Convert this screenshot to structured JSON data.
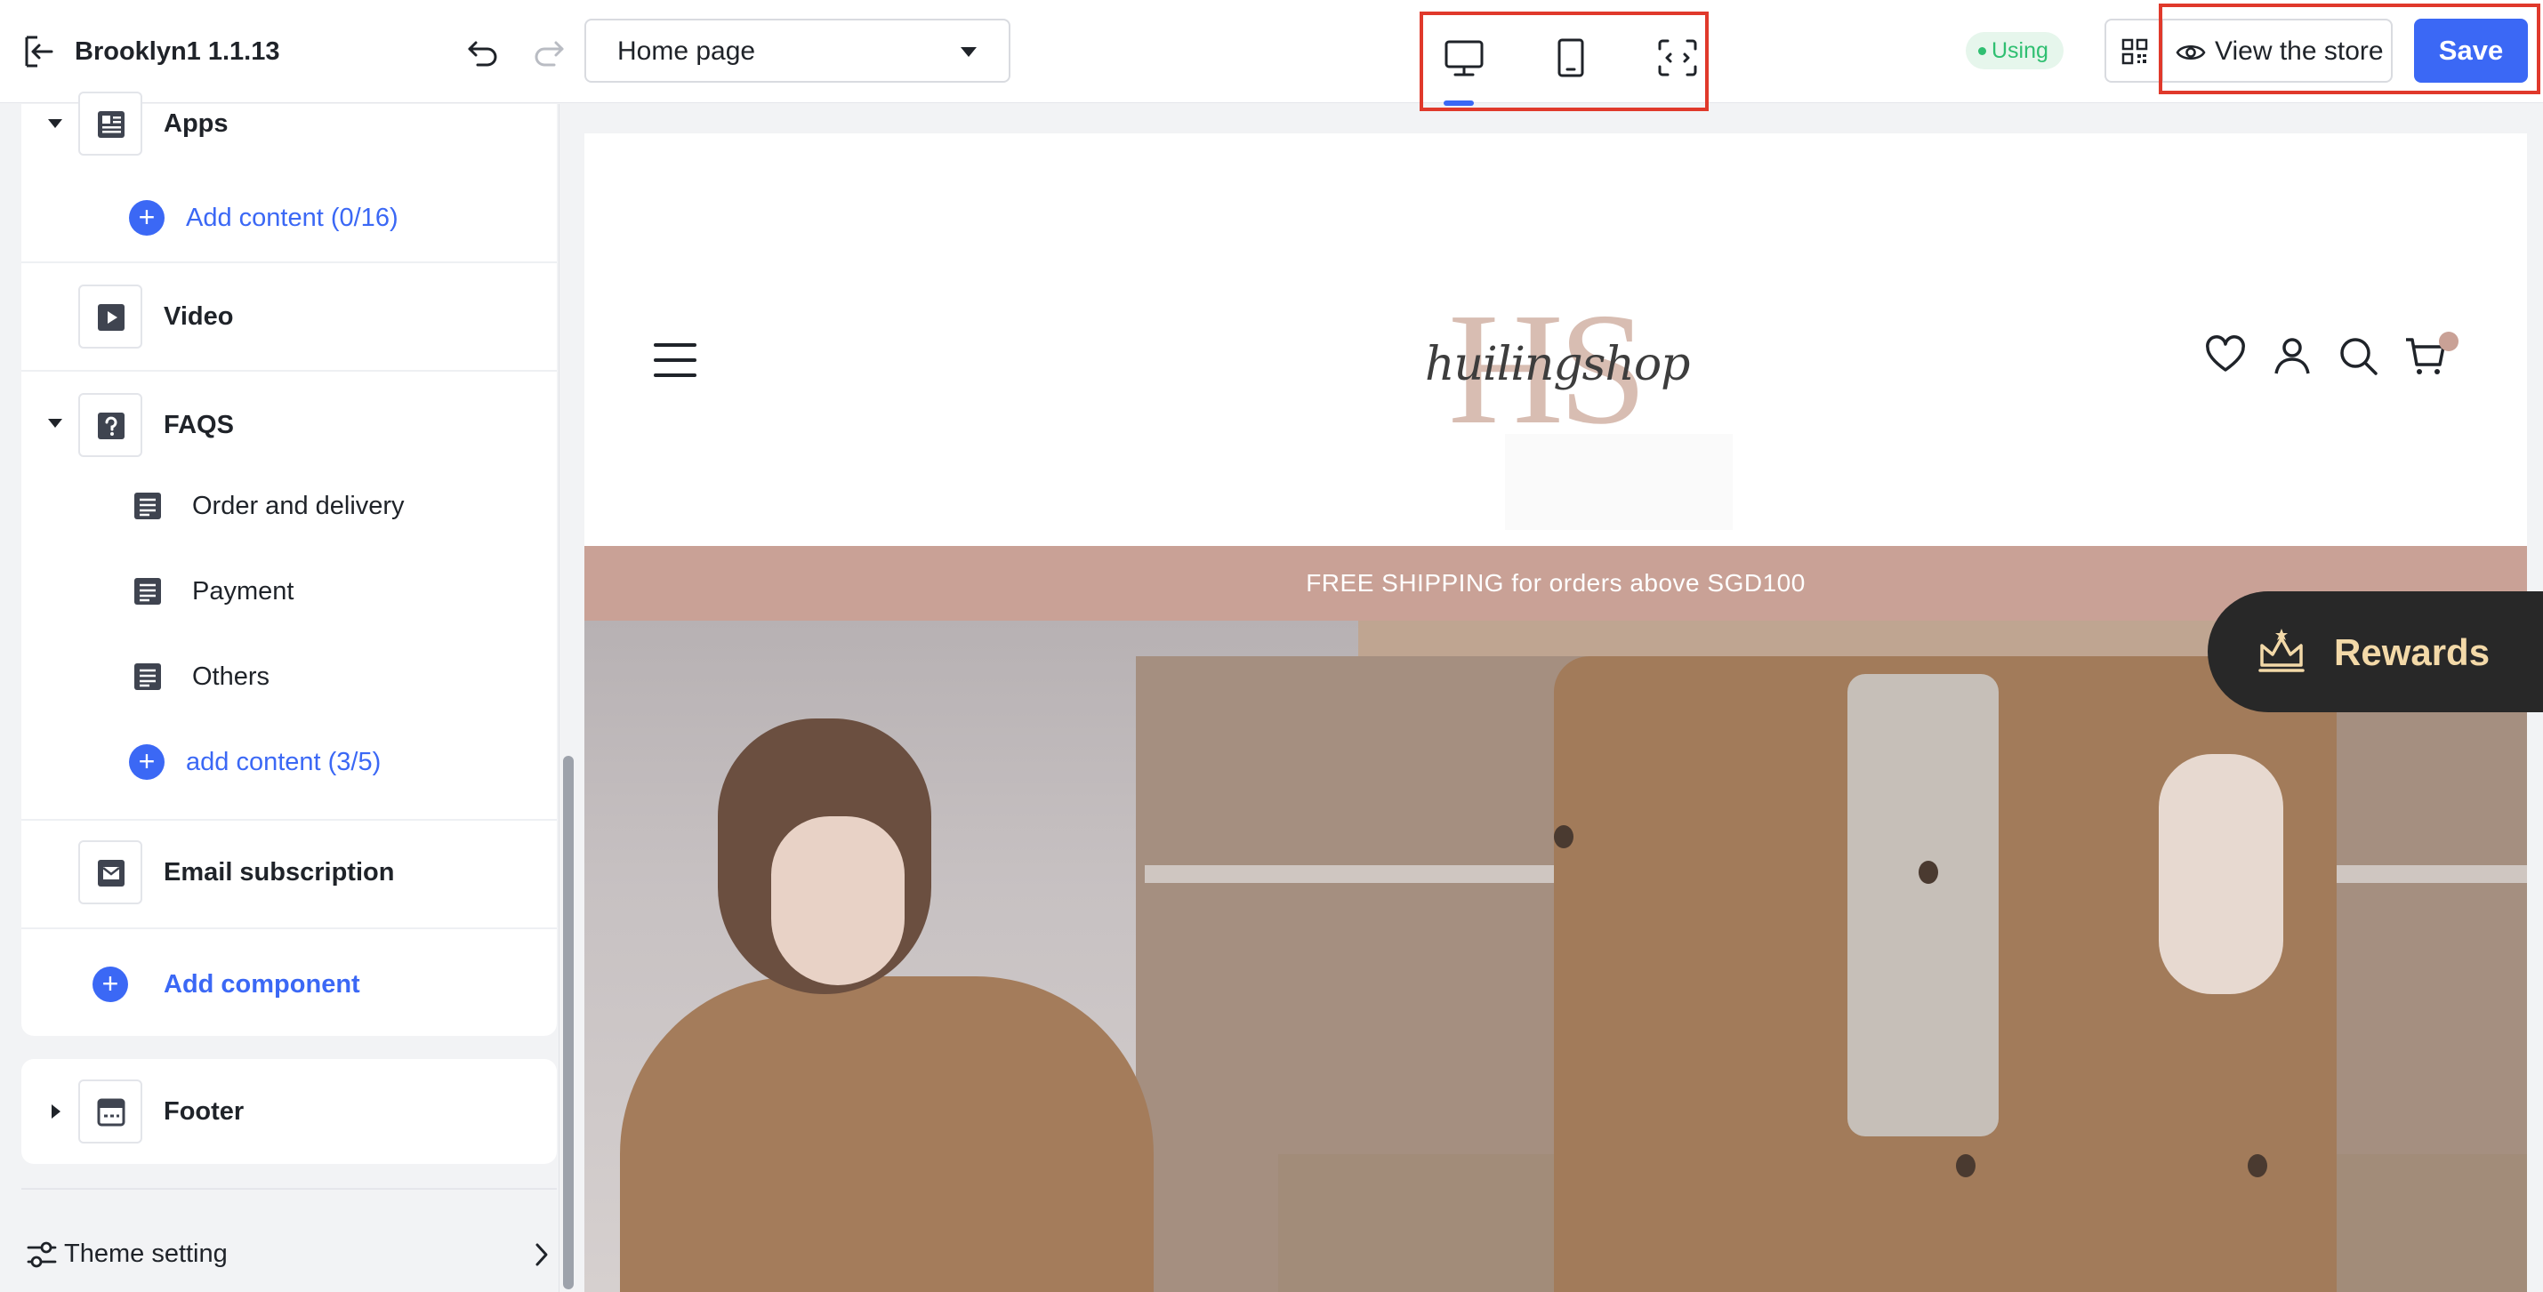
{
  "header": {
    "theme_name": "Brooklyn1 1.1.13",
    "page_selector": "Home page",
    "devices": [
      "desktop-icon",
      "tablet-icon",
      "fullscreen-icon"
    ],
    "active_device": "desktop",
    "status": "Using",
    "view_store": "View the store",
    "save": "Save"
  },
  "sidebar": {
    "sections": [
      {
        "label": "Apps",
        "icon": "apps-icon",
        "expanded": true,
        "add_link": "Add content (0/16)"
      },
      {
        "label": "Video",
        "icon": "video-icon"
      },
      {
        "label": "FAQS",
        "icon": "faq-icon",
        "expanded": true,
        "items": [
          "Order and delivery",
          "Payment",
          "Others"
        ],
        "add_link": "add content (3/5)"
      },
      {
        "label": "Email subscription",
        "icon": "email-icon"
      }
    ],
    "add_component": "Add component",
    "footer": {
      "label": "Footer",
      "icon": "footer-icon",
      "expanded": false
    },
    "theme_setting": "Theme setting"
  },
  "preview": {
    "logo_letters": "HS",
    "logo_script": "huilingshop",
    "announcement": "FREE SHIPPING for orders above SGD100",
    "rewards": "Rewards"
  },
  "colors": {
    "accent": "#3b68f5",
    "highlight": "#e0392b",
    "status_green": "#2fbf71",
    "announcement_bg": "#c9a196",
    "rewards_bg": "#282828",
    "rewards_text": "#f3d9a8"
  }
}
